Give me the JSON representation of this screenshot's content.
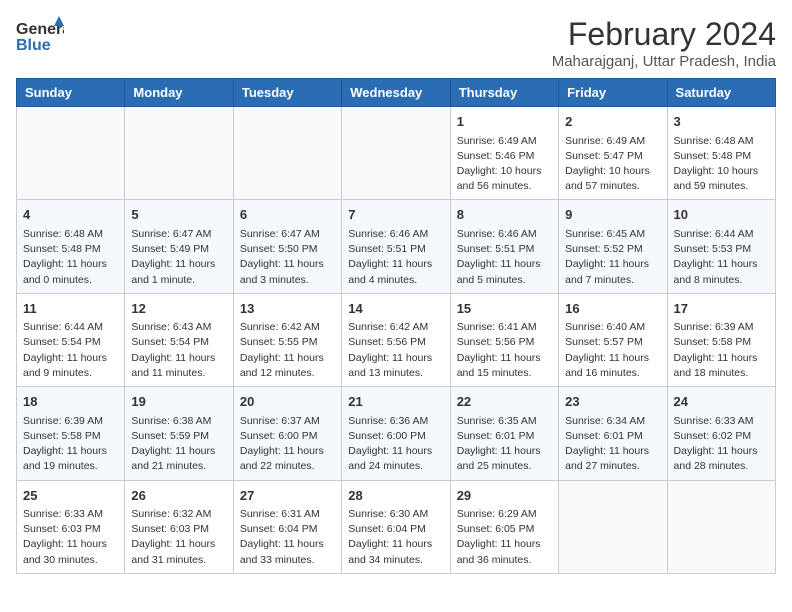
{
  "header": {
    "logo_general": "General",
    "logo_blue": "Blue",
    "month_year": "February 2024",
    "location": "Maharajganj, Uttar Pradesh, India"
  },
  "weekdays": [
    "Sunday",
    "Monday",
    "Tuesday",
    "Wednesday",
    "Thursday",
    "Friday",
    "Saturday"
  ],
  "weeks": [
    [
      {
        "day": "",
        "info": ""
      },
      {
        "day": "",
        "info": ""
      },
      {
        "day": "",
        "info": ""
      },
      {
        "day": "",
        "info": ""
      },
      {
        "day": "1",
        "info": "Sunrise: 6:49 AM\nSunset: 5:46 PM\nDaylight: 10 hours\nand 56 minutes."
      },
      {
        "day": "2",
        "info": "Sunrise: 6:49 AM\nSunset: 5:47 PM\nDaylight: 10 hours\nand 57 minutes."
      },
      {
        "day": "3",
        "info": "Sunrise: 6:48 AM\nSunset: 5:48 PM\nDaylight: 10 hours\nand 59 minutes."
      }
    ],
    [
      {
        "day": "4",
        "info": "Sunrise: 6:48 AM\nSunset: 5:48 PM\nDaylight: 11 hours\nand 0 minutes."
      },
      {
        "day": "5",
        "info": "Sunrise: 6:47 AM\nSunset: 5:49 PM\nDaylight: 11 hours\nand 1 minute."
      },
      {
        "day": "6",
        "info": "Sunrise: 6:47 AM\nSunset: 5:50 PM\nDaylight: 11 hours\nand 3 minutes."
      },
      {
        "day": "7",
        "info": "Sunrise: 6:46 AM\nSunset: 5:51 PM\nDaylight: 11 hours\nand 4 minutes."
      },
      {
        "day": "8",
        "info": "Sunrise: 6:46 AM\nSunset: 5:51 PM\nDaylight: 11 hours\nand 5 minutes."
      },
      {
        "day": "9",
        "info": "Sunrise: 6:45 AM\nSunset: 5:52 PM\nDaylight: 11 hours\nand 7 minutes."
      },
      {
        "day": "10",
        "info": "Sunrise: 6:44 AM\nSunset: 5:53 PM\nDaylight: 11 hours\nand 8 minutes."
      }
    ],
    [
      {
        "day": "11",
        "info": "Sunrise: 6:44 AM\nSunset: 5:54 PM\nDaylight: 11 hours\nand 9 minutes."
      },
      {
        "day": "12",
        "info": "Sunrise: 6:43 AM\nSunset: 5:54 PM\nDaylight: 11 hours\nand 11 minutes."
      },
      {
        "day": "13",
        "info": "Sunrise: 6:42 AM\nSunset: 5:55 PM\nDaylight: 11 hours\nand 12 minutes."
      },
      {
        "day": "14",
        "info": "Sunrise: 6:42 AM\nSunset: 5:56 PM\nDaylight: 11 hours\nand 13 minutes."
      },
      {
        "day": "15",
        "info": "Sunrise: 6:41 AM\nSunset: 5:56 PM\nDaylight: 11 hours\nand 15 minutes."
      },
      {
        "day": "16",
        "info": "Sunrise: 6:40 AM\nSunset: 5:57 PM\nDaylight: 11 hours\nand 16 minutes."
      },
      {
        "day": "17",
        "info": "Sunrise: 6:39 AM\nSunset: 5:58 PM\nDaylight: 11 hours\nand 18 minutes."
      }
    ],
    [
      {
        "day": "18",
        "info": "Sunrise: 6:39 AM\nSunset: 5:58 PM\nDaylight: 11 hours\nand 19 minutes."
      },
      {
        "day": "19",
        "info": "Sunrise: 6:38 AM\nSunset: 5:59 PM\nDaylight: 11 hours\nand 21 minutes."
      },
      {
        "day": "20",
        "info": "Sunrise: 6:37 AM\nSunset: 6:00 PM\nDaylight: 11 hours\nand 22 minutes."
      },
      {
        "day": "21",
        "info": "Sunrise: 6:36 AM\nSunset: 6:00 PM\nDaylight: 11 hours\nand 24 minutes."
      },
      {
        "day": "22",
        "info": "Sunrise: 6:35 AM\nSunset: 6:01 PM\nDaylight: 11 hours\nand 25 minutes."
      },
      {
        "day": "23",
        "info": "Sunrise: 6:34 AM\nSunset: 6:01 PM\nDaylight: 11 hours\nand 27 minutes."
      },
      {
        "day": "24",
        "info": "Sunrise: 6:33 AM\nSunset: 6:02 PM\nDaylight: 11 hours\nand 28 minutes."
      }
    ],
    [
      {
        "day": "25",
        "info": "Sunrise: 6:33 AM\nSunset: 6:03 PM\nDaylight: 11 hours\nand 30 minutes."
      },
      {
        "day": "26",
        "info": "Sunrise: 6:32 AM\nSunset: 6:03 PM\nDaylight: 11 hours\nand 31 minutes."
      },
      {
        "day": "27",
        "info": "Sunrise: 6:31 AM\nSunset: 6:04 PM\nDaylight: 11 hours\nand 33 minutes."
      },
      {
        "day": "28",
        "info": "Sunrise: 6:30 AM\nSunset: 6:04 PM\nDaylight: 11 hours\nand 34 minutes."
      },
      {
        "day": "29",
        "info": "Sunrise: 6:29 AM\nSunset: 6:05 PM\nDaylight: 11 hours\nand 36 minutes."
      },
      {
        "day": "",
        "info": ""
      },
      {
        "day": "",
        "info": ""
      }
    ]
  ]
}
